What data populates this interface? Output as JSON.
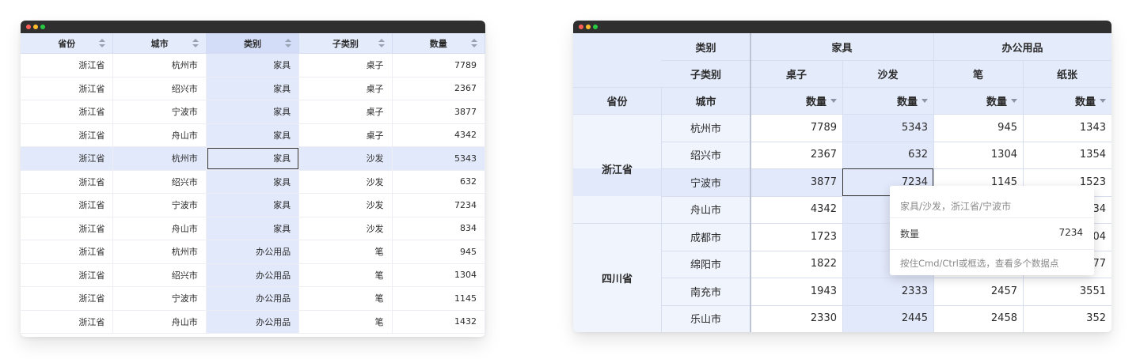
{
  "colors": {
    "titlebar": "#2f2f2f",
    "dot_red": "#ff5f57",
    "dot_yellow": "#febc2e",
    "dot_green": "#28c840",
    "header_bg": "#e4ebfb",
    "highlight": "#e2e9fb"
  },
  "flat_table": {
    "headers": [
      "省份",
      "城市",
      "类别",
      "子类别",
      "数量"
    ],
    "rows": [
      [
        "浙江省",
        "杭州市",
        "家具",
        "桌子",
        "7789"
      ],
      [
        "浙江省",
        "绍兴市",
        "家具",
        "桌子",
        "2367"
      ],
      [
        "浙江省",
        "宁波市",
        "家具",
        "桌子",
        "3877"
      ],
      [
        "浙江省",
        "舟山市",
        "家具",
        "桌子",
        "4342"
      ],
      [
        "浙江省",
        "杭州市",
        "家具",
        "沙发",
        "5343"
      ],
      [
        "浙江省",
        "绍兴市",
        "家具",
        "沙发",
        "632"
      ],
      [
        "浙江省",
        "宁波市",
        "家具",
        "沙发",
        "7234"
      ],
      [
        "浙江省",
        "舟山市",
        "家具",
        "沙发",
        "834"
      ],
      [
        "浙江省",
        "杭州市",
        "办公用品",
        "笔",
        "945"
      ],
      [
        "浙江省",
        "绍兴市",
        "办公用品",
        "笔",
        "1304"
      ],
      [
        "浙江省",
        "宁波市",
        "办公用品",
        "笔",
        "1145"
      ],
      [
        "浙江省",
        "舟山市",
        "办公用品",
        "笔",
        "1432"
      ]
    ]
  },
  "pivot_table": {
    "header_labels": {
      "category": "类别",
      "subcategory": "子类别",
      "province": "省份",
      "city": "城市",
      "measure": "数量"
    },
    "categories": [
      "家具",
      "办公用品"
    ],
    "subcategories": [
      "桌子",
      "沙发",
      "笔",
      "纸张"
    ],
    "provinces": [
      "浙江省",
      "四川省"
    ],
    "rows": [
      {
        "city": "杭州市",
        "values": [
          "7789",
          "5343",
          "945",
          "1343"
        ]
      },
      {
        "city": "绍兴市",
        "values": [
          "2367",
          "632",
          "1304",
          "1354"
        ]
      },
      {
        "city": "宁波市",
        "values": [
          "3877",
          "7234",
          "1145",
          "1523"
        ]
      },
      {
        "city": "舟山市",
        "values": [
          "4342",
          "",
          "",
          "34"
        ]
      },
      {
        "city": "成都市",
        "values": [
          "1723",
          "",
          "",
          "04"
        ]
      },
      {
        "city": "绵阳市",
        "values": [
          "1822",
          "",
          "",
          "77"
        ]
      },
      {
        "city": "南充市",
        "values": [
          "1943",
          "2333",
          "2457",
          "3551"
        ]
      },
      {
        "city": "乐山市",
        "values": [
          "2330",
          "2445",
          "2458",
          "352"
        ]
      }
    ]
  },
  "tooltip": {
    "title": "家具/沙发，浙江省/宁波市",
    "field": "数量",
    "value": "7234",
    "hint": "按住Cmd/Ctrl或框选，查看多个数据点"
  }
}
